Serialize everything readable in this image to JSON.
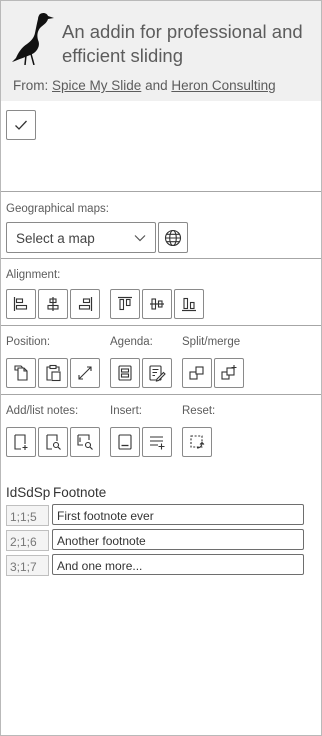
{
  "header": {
    "tagline": "An addin for professional and efficient sliding",
    "from_label": "From:",
    "link1": "Spice My Slide",
    "and": "and",
    "link2": "Heron Consulting",
    "logo": "heron-bird-logo"
  },
  "top_button": {
    "icon": "checkmark-icon"
  },
  "maps": {
    "label": "Geographical maps:",
    "select_placeholder": "Select a map",
    "globe": "globe-icon"
  },
  "alignment": {
    "label": "Alignment:",
    "buttons": [
      "align-left",
      "align-center",
      "align-right",
      "align-top",
      "align-middle",
      "align-bottom"
    ]
  },
  "position": {
    "label": "Position:",
    "buttons": [
      "copy-position",
      "paste-position",
      "swap-position"
    ]
  },
  "agenda": {
    "label": "Agenda:",
    "buttons": [
      "agenda",
      "agenda-edit"
    ]
  },
  "split": {
    "label": "Split/merge",
    "buttons": [
      "split",
      "merge"
    ]
  },
  "notes": {
    "label": "Add/list notes:",
    "buttons": [
      "add-note",
      "find-note",
      "list-notes"
    ]
  },
  "insert": {
    "label": "Insert:",
    "buttons": [
      "insert-footer",
      "insert-list"
    ]
  },
  "reset": {
    "label": "Reset:",
    "buttons": [
      "reset"
    ]
  },
  "footnotes": {
    "col_id": "IdSdSp",
    "col_note": "Footnote",
    "rows": [
      {
        "id": "1;1;5",
        "note": "First footnote ever"
      },
      {
        "id": "2;1;6",
        "note": "Another footnote"
      },
      {
        "id": "3;1;7",
        "note": "And one more..."
      }
    ]
  }
}
